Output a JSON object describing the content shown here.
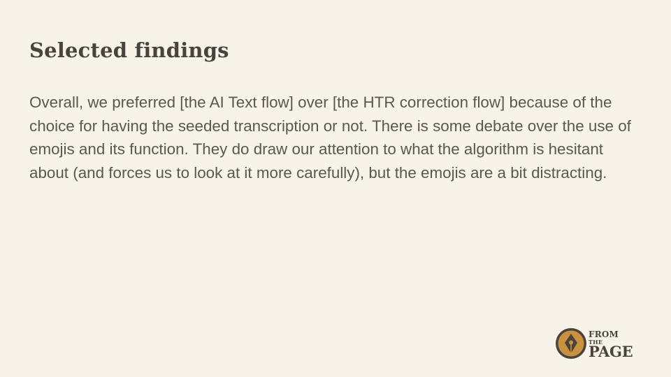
{
  "slide": {
    "title": "Selected findings",
    "body": "Overall, we preferred [the AI Text flow] over [the HTR correction flow] because of the choice for having the seeded transcription or not. There is some debate over the use of emojis and its function. They do draw our attention to what the algorithm is hesitant about (and forces us to look at it more carefully), but the emojis are a bit distracting."
  },
  "logo": {
    "icon": "pen-nib-icon",
    "line1": "FROM",
    "line2": "THE",
    "line3": "PAGE"
  },
  "colors": {
    "background": "#f7f3e8",
    "title": "#4a433d",
    "body": "#5c5650",
    "logo_ring": "#4a433d",
    "logo_fill": "#c9923f"
  }
}
